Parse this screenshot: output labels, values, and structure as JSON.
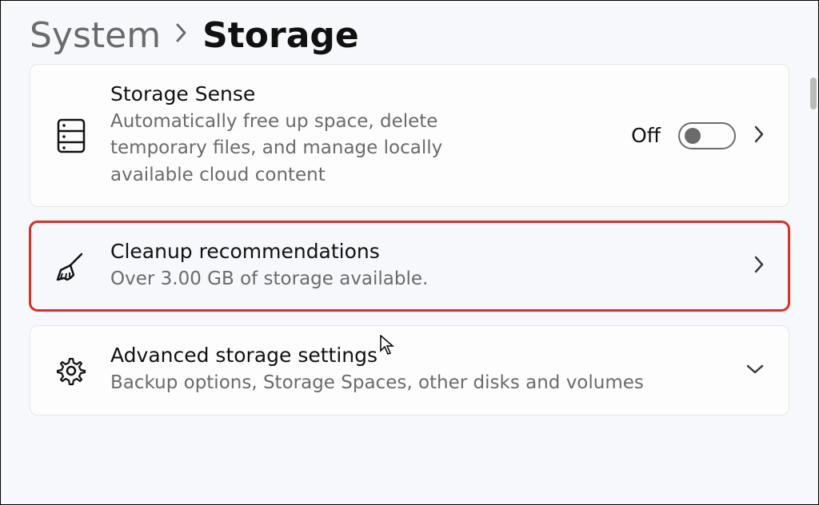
{
  "breadcrumb": {
    "parent": "System",
    "current": "Storage"
  },
  "cards": {
    "storage_sense": {
      "title": "Storage Sense",
      "subtitle": "Automatically free up space, delete temporary files, and manage locally available cloud content",
      "toggle_label": "Off",
      "toggle_state": "off"
    },
    "cleanup": {
      "title": "Cleanup recommendations",
      "subtitle": "Over 3.00 GB of storage available."
    },
    "advanced": {
      "title": "Advanced storage settings",
      "subtitle": "Backup options, Storage Spaces, other disks and volumes"
    }
  }
}
